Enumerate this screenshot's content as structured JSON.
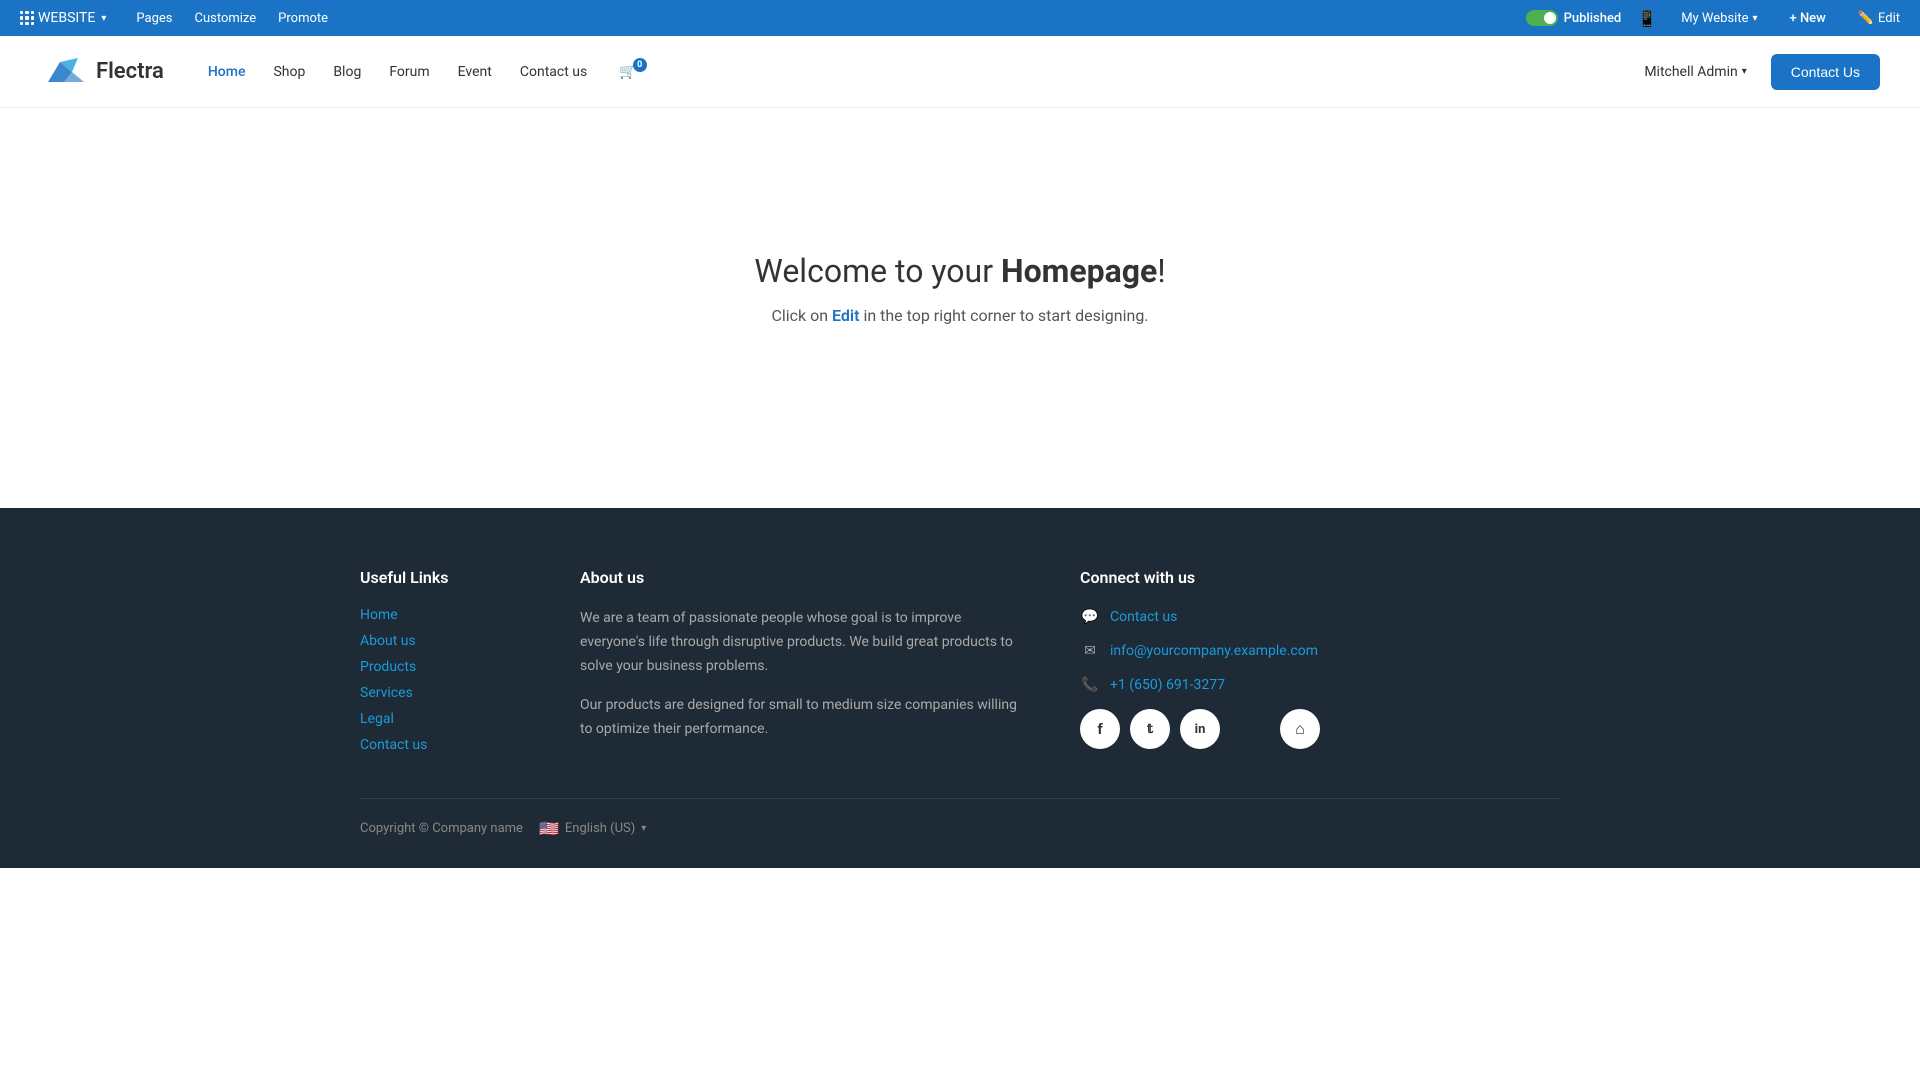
{
  "adminBar": {
    "websiteLabel": "WEBSITE",
    "pagesLabel": "Pages",
    "customizeLabel": "Customize",
    "promoteLabel": "Promote",
    "publishedLabel": "Published",
    "myWebsiteLabel": "My Website",
    "newLabel": "+ New",
    "editLabel": "Edit"
  },
  "header": {
    "logoText": "Flectra",
    "nav": {
      "home": "Home",
      "shop": "Shop",
      "blog": "Blog",
      "forum": "Forum",
      "event": "Event",
      "contactUs": "Contact us"
    },
    "cartCount": "0",
    "userLabel": "Mitchell Admin",
    "contactButton": "Contact Us"
  },
  "hero": {
    "titleStart": "Welcome to your ",
    "titleBold": "Homepage",
    "titleEnd": "!",
    "subtitle": "Click on ",
    "subtitleBold": "Edit",
    "subtitleEnd": " in the top right corner to start designing."
  },
  "footer": {
    "usefulLinks": {
      "heading": "Useful Links",
      "links": [
        "Home",
        "About us",
        "Products",
        "Services",
        "Legal",
        "Contact us"
      ]
    },
    "aboutUs": {
      "heading": "About us",
      "para1": "We are a team of passionate people whose goal is to improve everyone's life through disruptive products. We build great products to solve your business problems.",
      "para2": "Our products are designed for small to medium size companies willing to optimize their performance."
    },
    "connect": {
      "heading": "Connect with us",
      "contactLabel": "Contact us",
      "emailLabel": "info@yourcompany.example.com",
      "phoneLabel": "+1 (650) 691-3277"
    },
    "social": {
      "facebook": "f",
      "twitter": "t",
      "linkedin": "in",
      "home": "⌂"
    },
    "bottom": {
      "copyright": "Copyright © Company name",
      "language": "English (US)"
    }
  }
}
